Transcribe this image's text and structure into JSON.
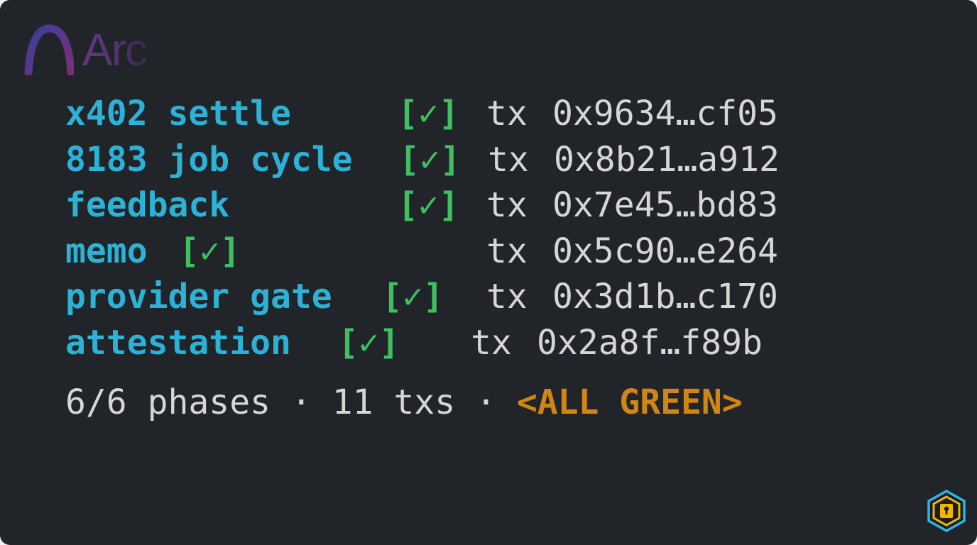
{
  "brand": {
    "name": "Arc",
    "logo_icon": "arc-logo-icon"
  },
  "phases": [
    {
      "name": "x402 settle",
      "status": "[✓]",
      "tx_prefix": "tx",
      "tx_hash": "0x9634…cf05"
    },
    {
      "name": "8183 job cycle",
      "status": "[✓]",
      "tx_prefix": "tx",
      "tx_hash": "0x8b21…a912"
    },
    {
      "name": "feedback",
      "status": "[✓]",
      "tx_prefix": "tx",
      "tx_hash": "0x7e45…bd83"
    },
    {
      "name": "memo",
      "status": "[✓]",
      "tx_prefix": "tx",
      "tx_hash": "0x5c90…e264"
    },
    {
      "name": "provider gate",
      "status": "[✓]",
      "tx_prefix": "tx",
      "tx_hash": "0x3d1b…c170"
    },
    {
      "name": "attestation",
      "status": "[✓]",
      "tx_prefix": "tx",
      "tx_hash": "0x2a8f…f89b"
    }
  ],
  "summary": {
    "phases": "6/6 phases",
    "separator": "·",
    "txs": "11 txs",
    "status": "<ALL GREEN>"
  },
  "colors": {
    "background": "#212428",
    "phase_name": "#2bb2d6",
    "check": "#3fc060",
    "tx_text": "#d6d6d6",
    "status": "#d18612",
    "badge_outline": "#29b6e8",
    "badge_fill": "#f2b600"
  },
  "badge_icon": "hexagon-keyhole-icon"
}
